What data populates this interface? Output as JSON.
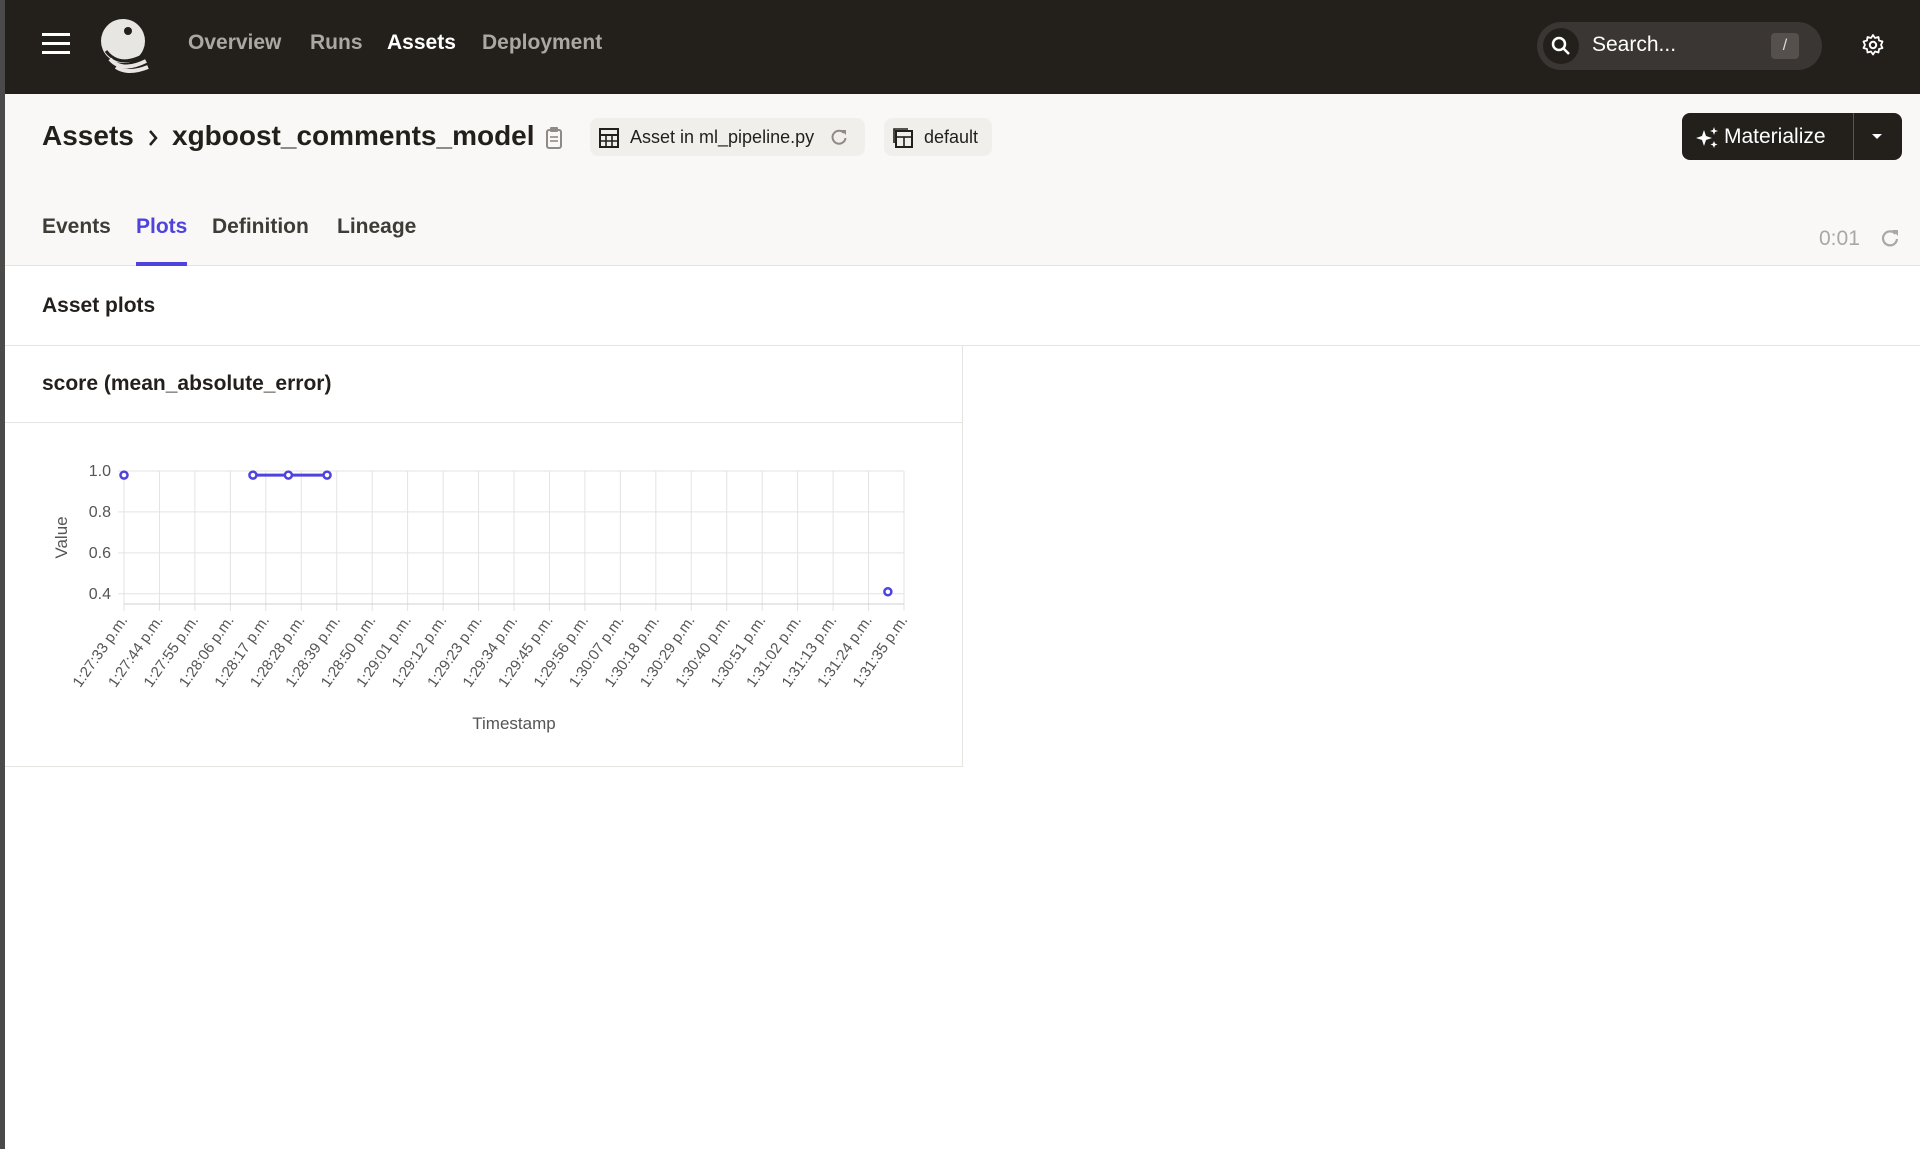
{
  "nav": {
    "items": [
      {
        "label": "Overview"
      },
      {
        "label": "Runs"
      },
      {
        "label": "Assets",
        "active": true
      },
      {
        "label": "Deployment"
      }
    ],
    "search_placeholder": "Search...",
    "search_shortcut": "/"
  },
  "header": {
    "breadcrumb_root": "Assets",
    "asset_name": "xgboost_comments_model",
    "code_location_tag": "Asset in ml_pipeline.py",
    "group_tag": "default",
    "materialize_label": "Materialize"
  },
  "tabs": [
    {
      "label": "Events"
    },
    {
      "label": "Plots",
      "active": true
    },
    {
      "label": "Definition"
    },
    {
      "label": "Lineage"
    }
  ],
  "refresh_timer": "0:01",
  "section_title": "Asset plots",
  "colors": {
    "accent": "#4f43dd",
    "topbar": "#231f1b"
  },
  "chart_data": {
    "type": "line",
    "title": "score (mean_absolute_error)",
    "xlabel": "Timestamp",
    "ylabel": "Value",
    "x_ticks": [
      "1:27:33 p.m.",
      "1:27:44 p.m.",
      "1:27:55 p.m.",
      "1:28:06 p.m.",
      "1:28:17 p.m.",
      "1:28:28 p.m.",
      "1:28:39 p.m.",
      "1:28:50 p.m.",
      "1:29:01 p.m.",
      "1:29:12 p.m.",
      "1:29:23 p.m.",
      "1:29:34 p.m.",
      "1:29:45 p.m.",
      "1:29:56 p.m.",
      "1:30:07 p.m.",
      "1:30:18 p.m.",
      "1:30:29 p.m.",
      "1:30:40 p.m.",
      "1:30:51 p.m.",
      "1:31:02 p.m.",
      "1:31:13 p.m.",
      "1:31:24 p.m.",
      "1:31:35 p.m."
    ],
    "y_ticks": [
      "0.4",
      "0.6",
      "0.8",
      "1.0"
    ],
    "ylim": [
      0.35,
      1.0
    ],
    "grid": true,
    "series": [
      {
        "segments": [
          [
            {
              "t": "1:27:33",
              "value": 0.98
            }
          ],
          [
            {
              "t": "1:28:13",
              "value": 0.98
            },
            {
              "t": "1:28:24",
              "value": 0.98
            },
            {
              "t": "1:28:36",
              "value": 0.98
            }
          ],
          [
            {
              "t": "1:31:30",
              "value": 0.41
            }
          ]
        ]
      }
    ]
  }
}
